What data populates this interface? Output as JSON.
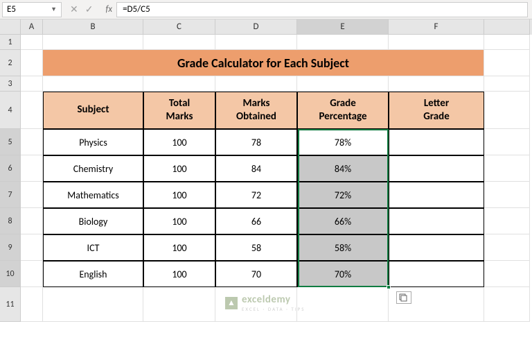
{
  "nameBox": "E5",
  "formula": "=D5/C5",
  "colHeads": {
    "A": "A",
    "B": "B",
    "C": "C",
    "D": "D",
    "E": "E",
    "F": "F"
  },
  "rowNums": {
    "r1": "1",
    "r2": "2",
    "r3": "3",
    "r4": "4",
    "r5": "5",
    "r6": "6",
    "r7": "7",
    "r8": "8",
    "r9": "9",
    "r10": "10",
    "r11": "11"
  },
  "title": "Grade Calculator for Each Subject",
  "headers": {
    "subject": "Subject",
    "total1": "Total",
    "total2": "Marks",
    "marks1": "Marks",
    "marks2": "Obtained",
    "grade1": "Grade",
    "grade2": "Percentage",
    "letter1": "Letter",
    "letter2": "Grade"
  },
  "rows": [
    {
      "subject": "Physics",
      "total": "100",
      "obtained": "78",
      "pct": "78%",
      "letter": ""
    },
    {
      "subject": "Chemistry",
      "total": "100",
      "obtained": "84",
      "pct": "84%",
      "letter": ""
    },
    {
      "subject": "Mathematics",
      "total": "100",
      "obtained": "72",
      "pct": "72%",
      "letter": ""
    },
    {
      "subject": "Biology",
      "total": "100",
      "obtained": "66",
      "pct": "66%",
      "letter": ""
    },
    {
      "subject": "ICT",
      "total": "100",
      "obtained": "58",
      "pct": "58%",
      "letter": ""
    },
    {
      "subject": "English",
      "total": "100",
      "obtained": "70",
      "pct": "70%",
      "letter": ""
    }
  ],
  "watermark": {
    "name": "exceldemy",
    "sub": "EXCEL · DATA · TIPS"
  }
}
